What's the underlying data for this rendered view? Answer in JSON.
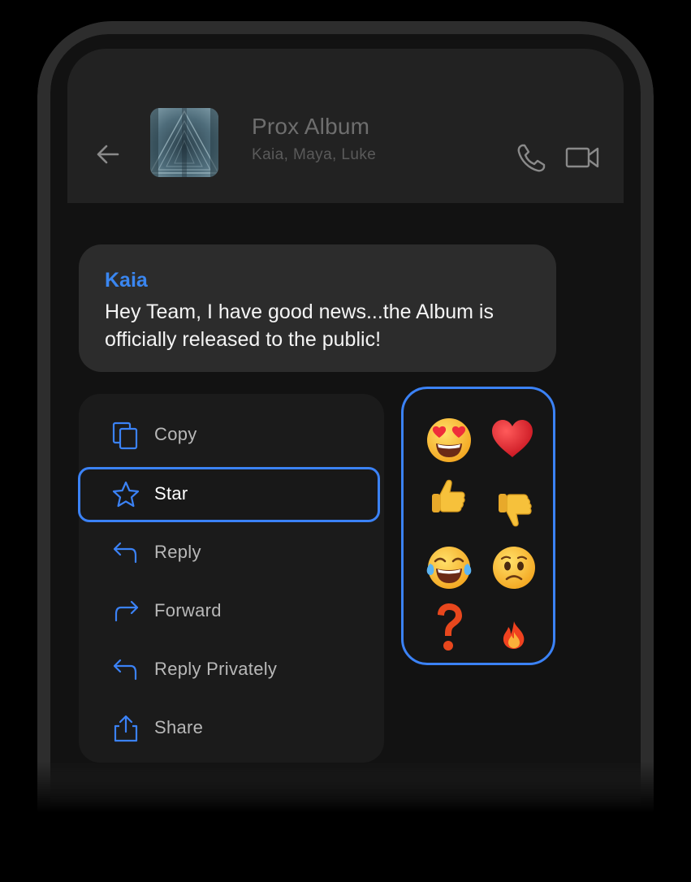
{
  "header": {
    "title": "Prox Album",
    "subtitle": "Kaia, Maya, Luke",
    "icons": [
      "back-arrow-icon",
      "phone-icon",
      "video-camera-icon"
    ]
  },
  "message": {
    "sender": "Kaia",
    "text": "Hey Team, I have good news...the Album is officially released to the public!"
  },
  "menu": {
    "items": [
      {
        "label": "Copy",
        "icon": "copy-icon"
      },
      {
        "label": "Star",
        "icon": "star-icon",
        "selected": true
      },
      {
        "label": "Reply",
        "icon": "reply-icon"
      },
      {
        "label": "Forward",
        "icon": "forward-icon"
      },
      {
        "label": "Reply Privately",
        "icon": "reply-privately-icon"
      },
      {
        "label": "Share",
        "icon": "share-icon"
      }
    ]
  },
  "reactions": [
    "heart-eyes",
    "red-heart",
    "thumbs-up",
    "thumbs-down",
    "tears-of-joy",
    "worried",
    "question-mark",
    "fire"
  ],
  "colors": {
    "accent": "#3b82f6",
    "sender_name": "#3a86f0",
    "background": "#121212",
    "bubble": "#2c2c2c",
    "menu": "#1b1b1b"
  }
}
